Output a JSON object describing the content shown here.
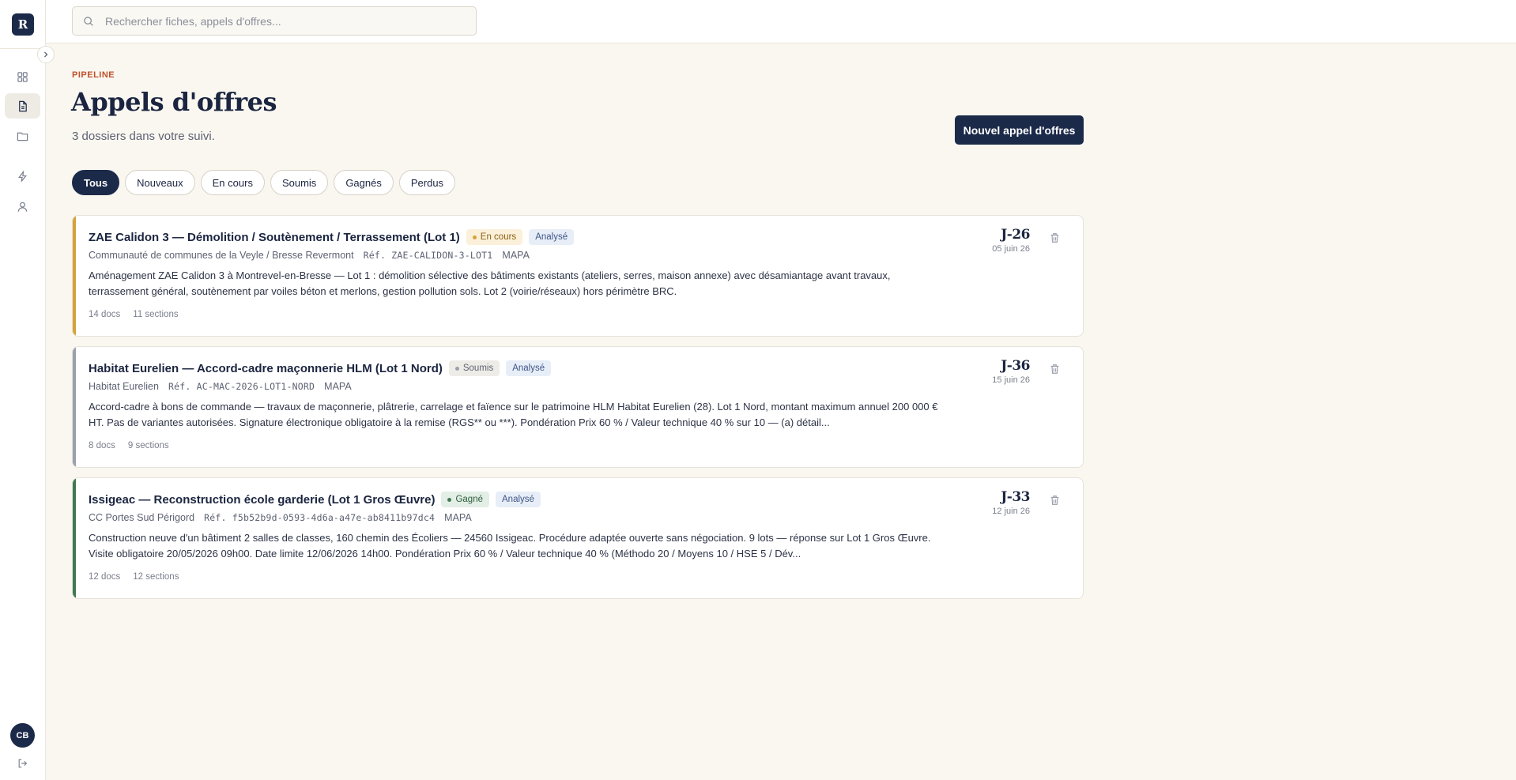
{
  "sidebar": {
    "logo_letter": "R",
    "user_initials": "CB",
    "icons": [
      "dashboard-icon",
      "document-icon",
      "folder-icon",
      "lightning-icon",
      "user-icon"
    ]
  },
  "search": {
    "placeholder": "Rechercher fiches, appels d'offres..."
  },
  "header": {
    "eyebrow": "PIPELINE",
    "title": "Appels d'offres",
    "subtitle": "3 dossiers dans votre suivi.",
    "new_button": "Nouvel appel d'offres"
  },
  "filters": [
    "Tous",
    "Nouveaux",
    "En cours",
    "Soumis",
    "Gagnés",
    "Perdus"
  ],
  "active_filter": "Tous",
  "colors": {
    "navy": "#1c2a4a",
    "accent_en_cours": "#d6a33a",
    "accent_soumis": "#9aa0ad",
    "accent_gagne": "#3f7a52"
  },
  "cards": [
    {
      "title": "ZAE Calidon 3 — Démolition / Soutènement / Terrassement (Lot 1)",
      "status": "En cours",
      "analysis": "Analysé",
      "buyer": "Communauté de communes de la Veyle / Bresse Revermont",
      "ref": "Réf. ZAE-CALIDON-3-LOT1",
      "procedure": "MAPA",
      "description": "Aménagement ZAE Calidon 3 à Montrevel-en-Bresse — Lot 1 : démolition sélective des bâtiments existants (ateliers, serres, maison annexe) avec désamiantage avant travaux, terrassement général, soutènement par voiles béton et merlons, gestion pollution sols. Lot 2 (voirie/réseaux) hors périmètre BRC.",
      "docs": "14 docs",
      "sections": "11 sections",
      "countdown": "J-26",
      "date": "05 juin 26"
    },
    {
      "title": "Habitat Eurelien — Accord-cadre maçonnerie HLM (Lot 1 Nord)",
      "status": "Soumis",
      "analysis": "Analysé",
      "buyer": "Habitat Eurelien",
      "ref": "Réf. AC-MAC-2026-LOT1-NORD",
      "procedure": "MAPA",
      "description": "Accord-cadre à bons de commande — travaux de maçonnerie, plâtrerie, carrelage et faïence sur le patrimoine HLM Habitat Eurelien (28). Lot 1 Nord, montant maximum annuel 200 000 € HT. Pas de variantes autorisées. Signature électronique obligatoire à la remise (RGS** ou ***). Pondération Prix 60 % / Valeur technique 40 % sur 10 — (a) détail...",
      "docs": "8 docs",
      "sections": "9 sections",
      "countdown": "J-36",
      "date": "15 juin 26"
    },
    {
      "title": "Issigeac — Reconstruction école garderie (Lot 1 Gros Œuvre)",
      "status": "Gagné",
      "analysis": "Analysé",
      "buyer": "CC Portes Sud Périgord",
      "ref": "Réf. f5b52b9d-0593-4d6a-a47e-ab8411b97dc4",
      "procedure": "MAPA",
      "description": "Construction neuve d'un bâtiment 2 salles de classes, 160 chemin des Écoliers — 24560 Issigeac. Procédure adaptée ouverte sans négociation. 9 lots — réponse sur Lot 1 Gros Œuvre. Visite obligatoire 20/05/2026 09h00. Date limite 12/06/2026 14h00. Pondération Prix 60 % / Valeur technique 40 % (Méthodo 20 / Moyens 10 / HSE 5 / Dév...",
      "docs": "12 docs",
      "sections": "12 sections",
      "countdown": "J-33",
      "date": "12 juin 26"
    }
  ]
}
